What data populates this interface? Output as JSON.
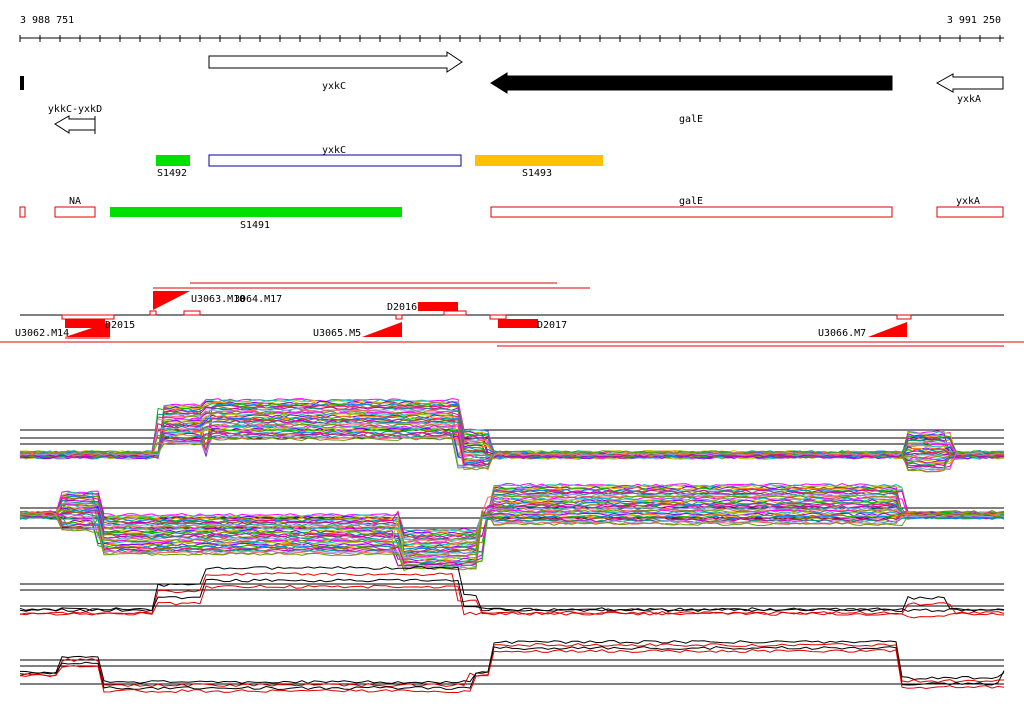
{
  "ruler": {
    "start_label": "3 988 751",
    "end_label": "3 991 250"
  },
  "genes": [
    {
      "label": "ykkC-yxkD"
    },
    {
      "label": "yxkC"
    },
    {
      "label": "galE"
    },
    {
      "label": "yxkA"
    }
  ],
  "segments": {
    "track1": [
      {
        "label": "S1492"
      },
      {
        "label": "yxkC"
      },
      {
        "label": "S1493"
      }
    ],
    "track2": [
      {
        "label": "NA"
      },
      {
        "label": "S1491"
      },
      {
        "label": "galE"
      },
      {
        "label": "yxkA"
      }
    ]
  },
  "features": [
    {
      "label": "U3062.M14"
    },
    {
      "label": "D2015"
    },
    {
      "label": "U3063.M10"
    },
    {
      "label": "3064.M17"
    },
    {
      "label": "D2016"
    },
    {
      "label": "U3065.M5"
    },
    {
      "label": "D2017"
    },
    {
      "label": "U3066.M7"
    }
  ],
  "colors": {
    "green": "#00e000",
    "orange": "#ffc000",
    "red": "#ff0000",
    "blue": "#0000a0",
    "gene_fill": "#000000"
  }
}
